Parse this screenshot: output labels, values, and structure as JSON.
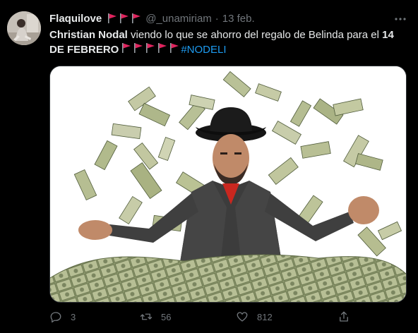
{
  "tweet": {
    "display_name": "Flaquilove",
    "handle": "@_unamiriam",
    "separator": "·",
    "date": "13 feb.",
    "text_bold_1": "Christian Nodal",
    "text_mid": " viendo lo que se ahorro del regalo de Belinda para el ",
    "text_bold_2": "14 DE FEBRERO",
    "hashtag": "#NODELI"
  },
  "actions": {
    "reply_count": "3",
    "retweet_count": "56",
    "like_count": "812"
  },
  "icons": {
    "more": "more-icon",
    "reply": "reply-icon",
    "retweet": "retweet-icon",
    "like": "heart-icon",
    "share": "share-icon",
    "flag": "red-flag-icon"
  },
  "colors": {
    "background": "#000000",
    "text": "#e7e9ea",
    "muted": "#71767b",
    "accent": "#1d9bf0",
    "flag": "#e0245e"
  }
}
